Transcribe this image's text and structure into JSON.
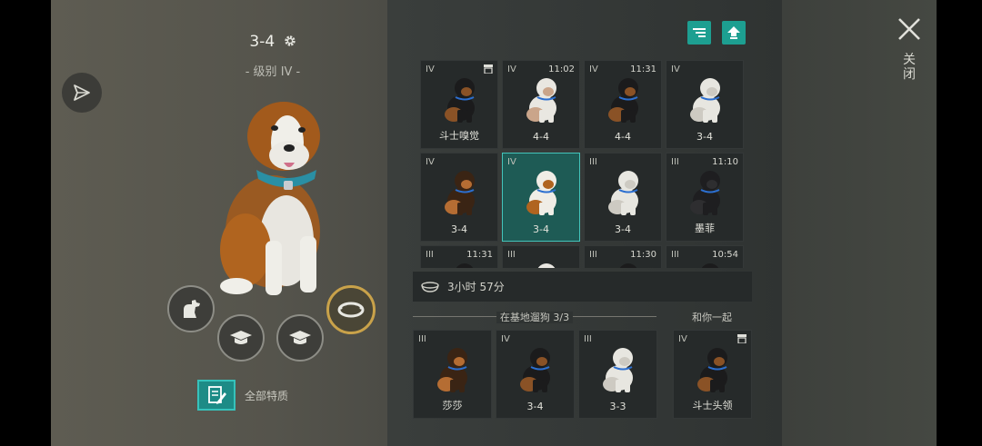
{
  "profile": {
    "title": "3-4",
    "level": "- 级别 IV -",
    "traits_label": "全部特质"
  },
  "icons": {
    "share": "share-icon",
    "settings": "gear-icon",
    "dog_action": "sit-dog-icon",
    "training_1": "graduation-cap-icon",
    "training_2": "graduation-cap-icon",
    "collar": "collar-icon",
    "traits": "notes-icon",
    "sort": "sort-list-icon",
    "upgrade": "arrow-up-icon",
    "bowl": "food-bowl-icon",
    "close": "close-icon"
  },
  "colors": {
    "accent_teal": "#1d9f91",
    "selected_gold": "#c9a24a",
    "selected_cell": "#1e5b55"
  },
  "grid": {
    "cells": [
      {
        "level": "IV",
        "time": "",
        "name": "斗士嗅觉",
        "badge": true,
        "dog": "rottweiler"
      },
      {
        "level": "IV",
        "time": "11:02",
        "name": "4-4",
        "badge": false,
        "dog": "puppy-white"
      },
      {
        "level": "IV",
        "time": "11:31",
        "name": "4-4",
        "badge": false,
        "dog": "rottweiler-small"
      },
      {
        "level": "IV",
        "time": "",
        "name": "3-4",
        "badge": false,
        "dog": "white-husky"
      },
      {
        "level": "IV",
        "time": "",
        "name": "3-4",
        "badge": false,
        "dog": "shepherd"
      },
      {
        "level": "IV",
        "time": "",
        "name": "3-4",
        "badge": false,
        "dog": "saint-bernard",
        "selected": true
      },
      {
        "level": "III",
        "time": "",
        "name": "3-4",
        "badge": false,
        "dog": "white-husky"
      },
      {
        "level": "III",
        "time": "11:10",
        "name": "墨菲",
        "badge": false,
        "dog": "black-puppy"
      },
      {
        "level": "III",
        "time": "11:31",
        "name": "",
        "badge": false,
        "dog": "rottweiler"
      },
      {
        "level": "III",
        "time": "",
        "name": "",
        "badge": false,
        "dog": "puppy-white"
      },
      {
        "level": "III",
        "time": "11:30",
        "name": "",
        "badge": false,
        "dog": "rottweiler"
      },
      {
        "level": "III",
        "time": "10:54",
        "name": "",
        "badge": false,
        "dog": "rottweiler"
      }
    ]
  },
  "timer": {
    "text": "3小时 57分"
  },
  "walk": {
    "label": "在基地遛狗 3/3",
    "with_label": "和你一起",
    "dogs": [
      {
        "level": "III",
        "name": "莎莎",
        "dog": "shepherd"
      },
      {
        "level": "IV",
        "name": "3-4",
        "dog": "rottweiler"
      },
      {
        "level": "III",
        "name": "3-3",
        "dog": "white-husky"
      }
    ],
    "with_dog": {
      "level": "IV",
      "name": "斗士头领",
      "badge": true,
      "dog": "rottweiler"
    }
  },
  "close": {
    "label": "关闭"
  }
}
